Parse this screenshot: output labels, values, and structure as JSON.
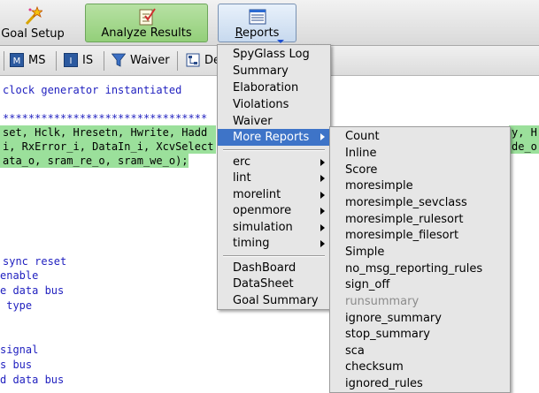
{
  "toolbar": {
    "goal_setup": "Goal Setup",
    "analyze_results": "Analyze Results",
    "reports_r": "R",
    "reports_rest": "eports"
  },
  "toolbar2": {
    "ms": "MS",
    "is": "IS",
    "waiver": "Waiver",
    "de": "De"
  },
  "code": {
    "lines": [
      "clock generator instantiated",
      "",
      "********************************",
      "set, Hclk, Hresetn, Hwrite, Hadd",
      "i, RxError_i, DataIn_i, XcvSelect",
      "ata_o, sram_re_o, sram_we_o);",
      "sync reset",
      "enable",
      "e data bus",
      " type",
      "signal",
      "s bus",
      "d data bus"
    ],
    "right_fragments": [
      "y, Hre",
      "de_o,"
    ]
  },
  "reports_menu": {
    "items": [
      "SpyGlass Log",
      "Summary",
      "Elaboration",
      "Violations",
      "Waiver",
      "More Reports"
    ],
    "group2": [
      "erc",
      "lint",
      "morelint",
      "openmore",
      "simulation",
      "timing"
    ],
    "group3": [
      "DashBoard",
      "DataSheet",
      "Goal Summary"
    ]
  },
  "more_reports_menu": {
    "items": [
      "Count",
      "Inline",
      "Score",
      "moresimple",
      "moresimple_sevclass",
      "moresimple_rulesort",
      "moresimple_filesort",
      "Simple",
      "no_msg_reporting_rules",
      "sign_off",
      "runsummary",
      "ignore_summary",
      "stop_summary",
      "sca",
      "checksum",
      "ignored_rules"
    ]
  },
  "colors": {
    "highlight": "#9be09b",
    "menu_selected": "#3e74c8",
    "code_text": "#1f1fbf"
  }
}
